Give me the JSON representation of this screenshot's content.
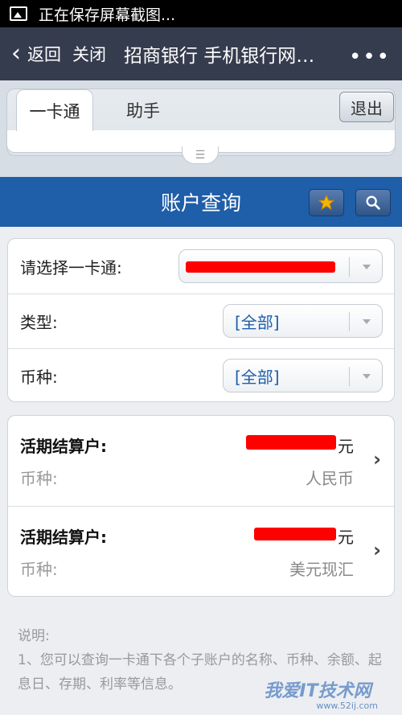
{
  "status_bar": {
    "text": "正在保存屏幕截图..."
  },
  "title_bar": {
    "back_label": "返回",
    "close_label": "关闭",
    "title": "招商银行 手机银行网…",
    "more": "•••"
  },
  "tabs": {
    "active": "一卡通",
    "inactive": "助手",
    "logout": "退出"
  },
  "header": {
    "title": "账户查询"
  },
  "form": {
    "card_label": "请选择一卡通:",
    "type_label": "类型:",
    "type_value": "[全部]",
    "currency_label": "币种:",
    "currency_value": "[全部]"
  },
  "accounts": [
    {
      "title": "活期结算户:",
      "amount_unit": "元",
      "currency_label": "币种:",
      "currency": "人民币"
    },
    {
      "title": "活期结算户:",
      "amount_unit": "元",
      "currency_label": "币种:",
      "currency": "美元现汇"
    }
  ],
  "notes": {
    "heading": "说明:",
    "line1": "1、您可以查询一卡通下各个子账户的名称、币种、余额、起息日、存期、利率等信息。"
  },
  "watermark": {
    "text": "我爱IT技术网",
    "url": "www.52ij.com"
  },
  "colors": {
    "title_bar": "#353c4e",
    "blue_bar": "#1f5ea8",
    "redaction": "#ff0000"
  }
}
